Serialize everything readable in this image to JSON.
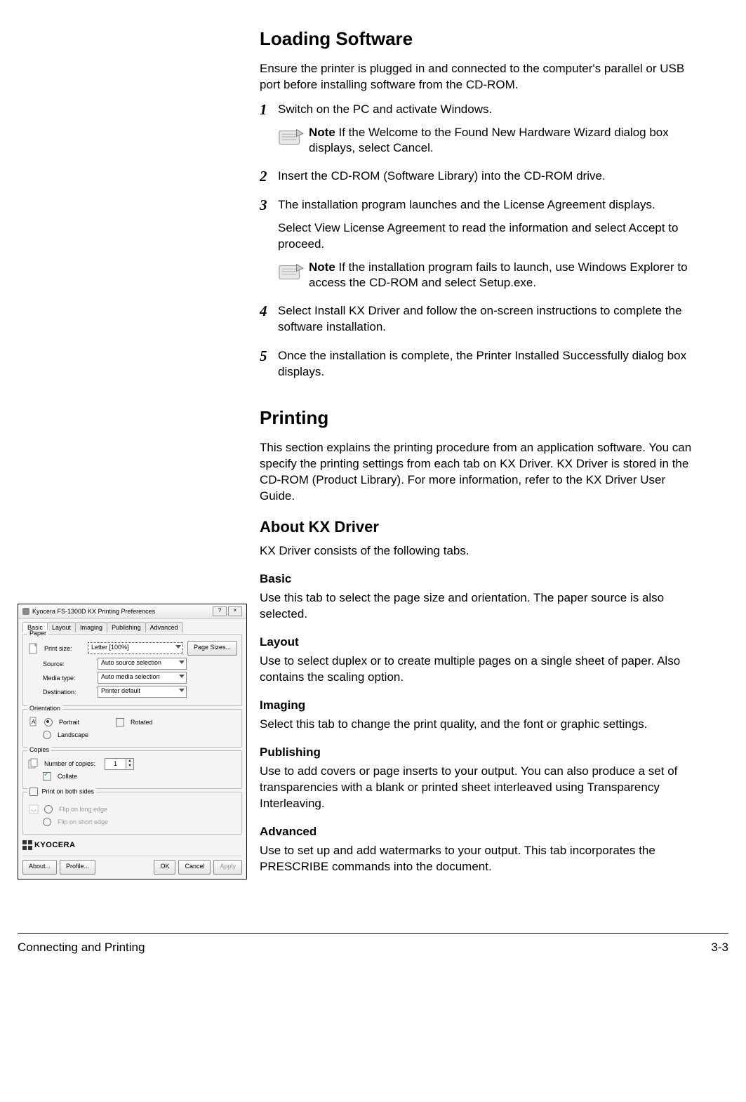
{
  "headings": {
    "loading_software": "Loading Software",
    "printing": "Printing",
    "about_kx": "About KX Driver"
  },
  "body": {
    "ls_intro": "Ensure the printer is plugged in and connected to the computer's parallel or USB port before installing software from the CD-ROM.",
    "step1": "Switch on the PC and activate Windows.",
    "note1_label": "Note",
    "note1": " If the Welcome to the Found New Hardware Wizard dialog box displays, select Cancel.",
    "step2": "Insert the CD-ROM (Software Library) into the CD-ROM drive.",
    "step3a": "The installation program launches and the License Agreement displays.",
    "step3b": "Select View License Agreement to read the information and select Accept to proceed.",
    "note2_label": "Note",
    "note2": " If the installation program fails to launch, use Windows Explorer to access the CD-ROM and select Setup.exe.",
    "step4": "Select Install KX Driver and follow the on-screen instructions to complete the software installation.",
    "step5": "Once the installation is complete, the Printer Installed Successfully dialog box displays.",
    "printing_intro": "This section explains the printing procedure from an application software. You can specify the printing settings from each tab on KX Driver. KX Driver is stored in the CD-ROM (Product Library). For more information, refer to the KX Driver User Guide.",
    "kx_intro": "KX Driver consists of the following tabs.",
    "basic_h": "Basic",
    "basic_p": "Use this tab to select the page size and orientation. The paper source is also selected.",
    "layout_h": "Layout",
    "layout_p": "Use to select duplex or to create multiple pages on a single sheet of paper. Also contains the scaling option.",
    "imaging_h": "Imaging",
    "imaging_p": "Select this tab to change the print quality, and the font or graphic settings.",
    "publishing_h": "Publishing",
    "publishing_p": "Use to add covers or page inserts to your output. You can also produce a set of transparencies with a blank or printed sheet interleaved using Transparency Interleaving.",
    "advanced_h": "Advanced",
    "advanced_p": "Use to set up and add watermarks to your output. This tab incorporates the PRESCRIBE commands into the document."
  },
  "stepnums": {
    "s1": "1",
    "s2": "2",
    "s3": "3",
    "s4": "4",
    "s5": "5"
  },
  "footer": {
    "left": "Connecting and Printing",
    "right": "3-3"
  },
  "dialog": {
    "title": "Kyocera FS-1300D KX Printing Preferences",
    "tabs": [
      "Basic",
      "Layout",
      "Imaging",
      "Publishing",
      "Advanced"
    ],
    "groups": {
      "paper": "Paper",
      "orientation": "Orientation",
      "copies": "Copies",
      "duplex": "Print on both sides"
    },
    "labels": {
      "print_size": "Print size:",
      "source": "Source:",
      "media_type": "Media type:",
      "destination": "Destination:",
      "page_sizes": "Page Sizes...",
      "portrait": "Portrait",
      "landscape": "Landscape",
      "rotated": "Rotated",
      "num_copies": "Number of copies:",
      "collate": "Collate",
      "flip_long": "Flip on long edge",
      "flip_short": "Flip on short edge"
    },
    "values": {
      "print_size": "Letter  [100%]",
      "source": "Auto source selection",
      "media_type": "Auto media selection",
      "destination": "Printer default",
      "copies": "1"
    },
    "logo": "KYOCERA",
    "buttons": {
      "about": "About...",
      "profile": "Profile...",
      "ok": "OK",
      "cancel": "Cancel",
      "apply": "Apply"
    }
  }
}
